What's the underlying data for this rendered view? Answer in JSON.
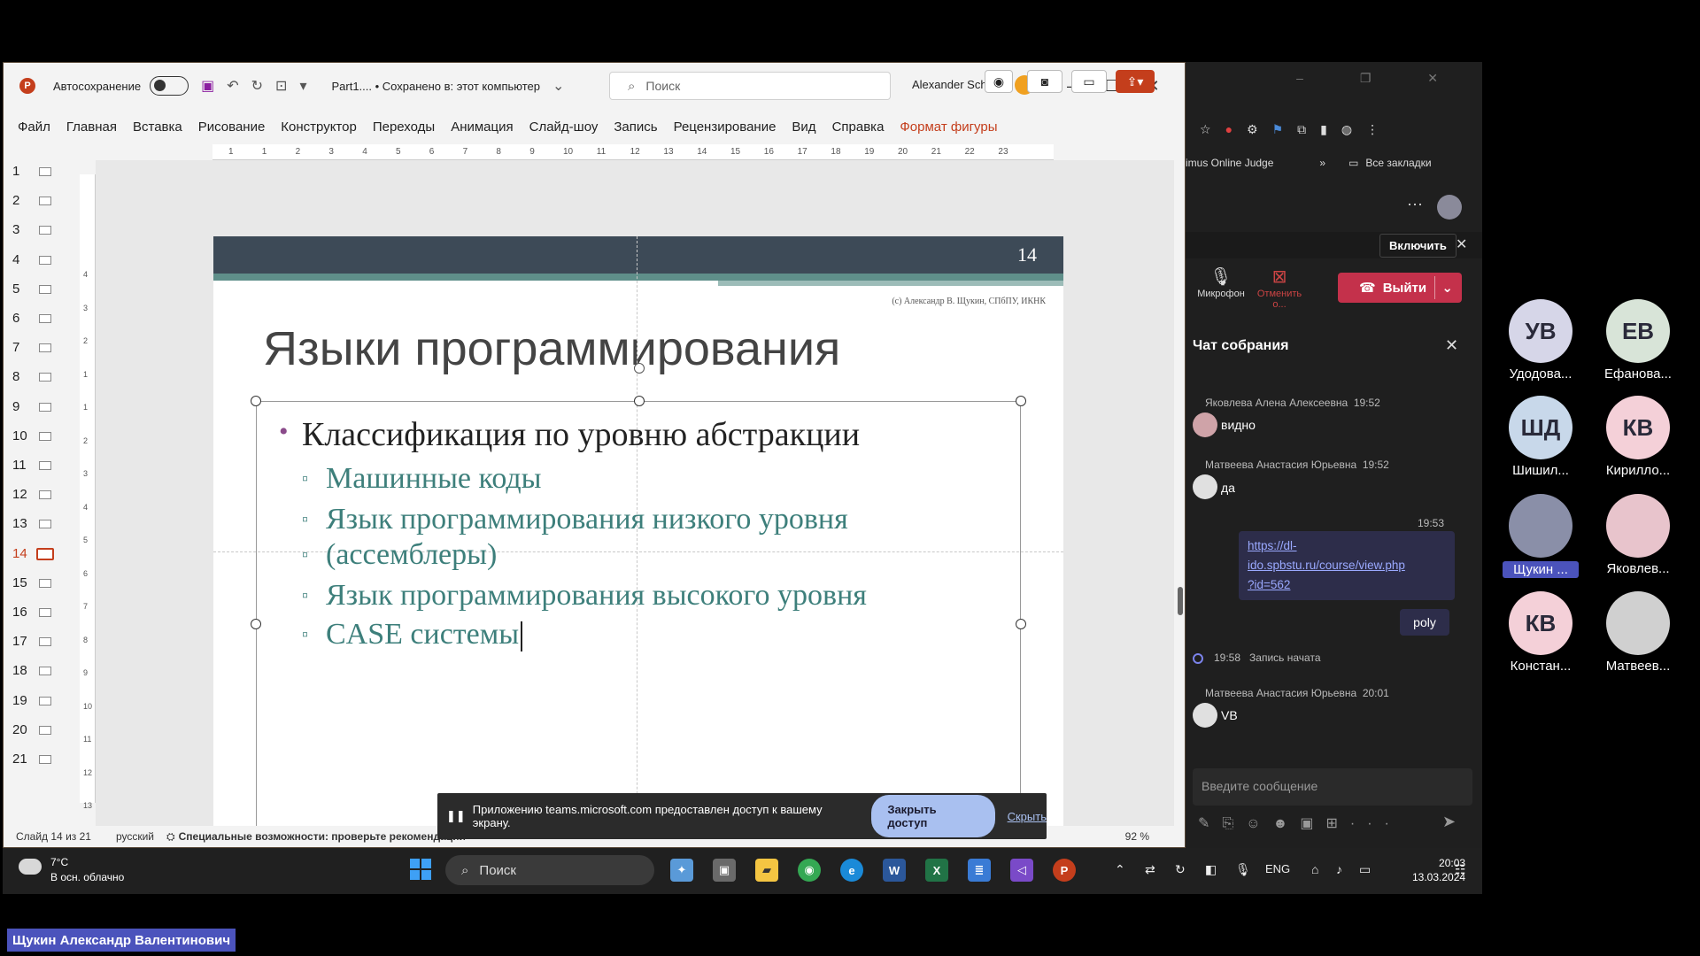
{
  "ppt": {
    "autosave_label": "Автосохранение",
    "file_status": "Part1.... • Сохранено в: этот компьютер",
    "search_placeholder": "Поиск",
    "user_name": "Alexander Schukin",
    "ribbon_tabs": [
      "Файл",
      "Главная",
      "Вставка",
      "Рисование",
      "Конструктор",
      "Переходы",
      "Анимация",
      "Слайд-шоу",
      "Запись",
      "Рецензирование",
      "Вид",
      "Справка",
      "Формат фигуры"
    ],
    "thumb_numbers": [
      "1",
      "2",
      "3",
      "4",
      "5",
      "6",
      "7",
      "8",
      "9",
      "10",
      "11",
      "12",
      "13",
      "14",
      "15",
      "16",
      "17",
      "18",
      "19",
      "20",
      "21"
    ],
    "active_slide_index": 13,
    "ruler_h": [
      "1",
      "1",
      "2",
      "3",
      "4",
      "5",
      "6",
      "7",
      "8",
      "9",
      "10",
      "11",
      "12",
      "13",
      "14",
      "15",
      "16",
      "17",
      "18",
      "19",
      "20",
      "21",
      "22",
      "23"
    ],
    "ruler_v": [
      "4",
      "3",
      "2",
      "1",
      "1",
      "2",
      "3",
      "4",
      "5",
      "6",
      "7",
      "8",
      "9",
      "10",
      "11",
      "12",
      "13"
    ],
    "slide": {
      "number": "14",
      "credit": "(c) Александр В. Щукин, СПбПУ, ИКНК",
      "title": "Языки программирования",
      "bullet": "Классификация по уровню абстракции",
      "sub": [
        "Машинные коды",
        "Язык программирования низкого уровня",
        "(ассемблеры)",
        "Язык программирования высокого уровня",
        "CASE системы"
      ]
    },
    "status": {
      "slide_of": "Слайд 14 из 21",
      "lang": "русский",
      "accessibility": "Специальные возможности: проверьте рекомендации",
      "zoom": "92 %"
    }
  },
  "share_notice": {
    "text": "Приложению teams.microsoft.com предоставлен доступ к вашему экрану.",
    "stop_button": "Закрыть доступ",
    "hide_link": "Скрыть"
  },
  "teams": {
    "bookmark_left": "imus Online Judge",
    "bookmark_right": "Все закладки",
    "enable_button": "Включить",
    "mic_label": "Микрофон",
    "stop_label": "Отменить о...",
    "leave_button": "Выйти",
    "chat_title": "Чат собрания",
    "messages": [
      {
        "author": "Яковлева Алена Алексеевна",
        "time": "19:52",
        "text": "видно"
      },
      {
        "author": "Матвеева Анастасия Юрьевна",
        "time": "19:52",
        "text": "да"
      },
      {
        "author": "Матвеева Анастасия Юрьевна",
        "time": "20:01",
        "text": "VB"
      }
    ],
    "my_time": "19:53",
    "my_link": "https://dl-ido.spbstu.ru/course/view.php?id=562",
    "my_link_lines": [
      "https://dl-",
      "ido.spbstu.ru/course/view.php",
      "?id=562"
    ],
    "my_poly": "poly",
    "rec_time": "19:58",
    "rec_text": "Запись начата",
    "compose_placeholder": "Введите сообщение",
    "participants": [
      {
        "initials": "УВ",
        "name": "Удодова...",
        "color": "#d6d6e8"
      },
      {
        "initials": "ЕВ",
        "name": "Ефанова...",
        "color": "#d8e4d8"
      },
      {
        "initials": "ШД",
        "name": "Шишил...",
        "color": "#c8d8ea"
      },
      {
        "initials": "КВ",
        "name": "Кирилло...",
        "color": "#f4d0d8"
      },
      {
        "initials": "",
        "name": "Щукин ...",
        "color": "#8a8fa8"
      },
      {
        "initials": "",
        "name": "Яковлев...",
        "color": "#e8c4cc"
      },
      {
        "initials": "КВ",
        "name": "Констан...",
        "color": "#f4d0d8"
      },
      {
        "initials": "",
        "name": "Матвеев...",
        "color": "#d0d0d0"
      }
    ]
  },
  "taskbar": {
    "temp": "7°C",
    "weather": "В осн. облачно",
    "search": "Поиск",
    "lang": "ENG",
    "time": "20:03",
    "date": "13.03.2024"
  },
  "speaker": "Щукин Александр Валентинович",
  "colors": {
    "ppt_accent": "#c43e1c",
    "teams_leave": "#c4314b",
    "teams_accent": "#4b53bc",
    "slide_teal": "#3d7f7b"
  }
}
